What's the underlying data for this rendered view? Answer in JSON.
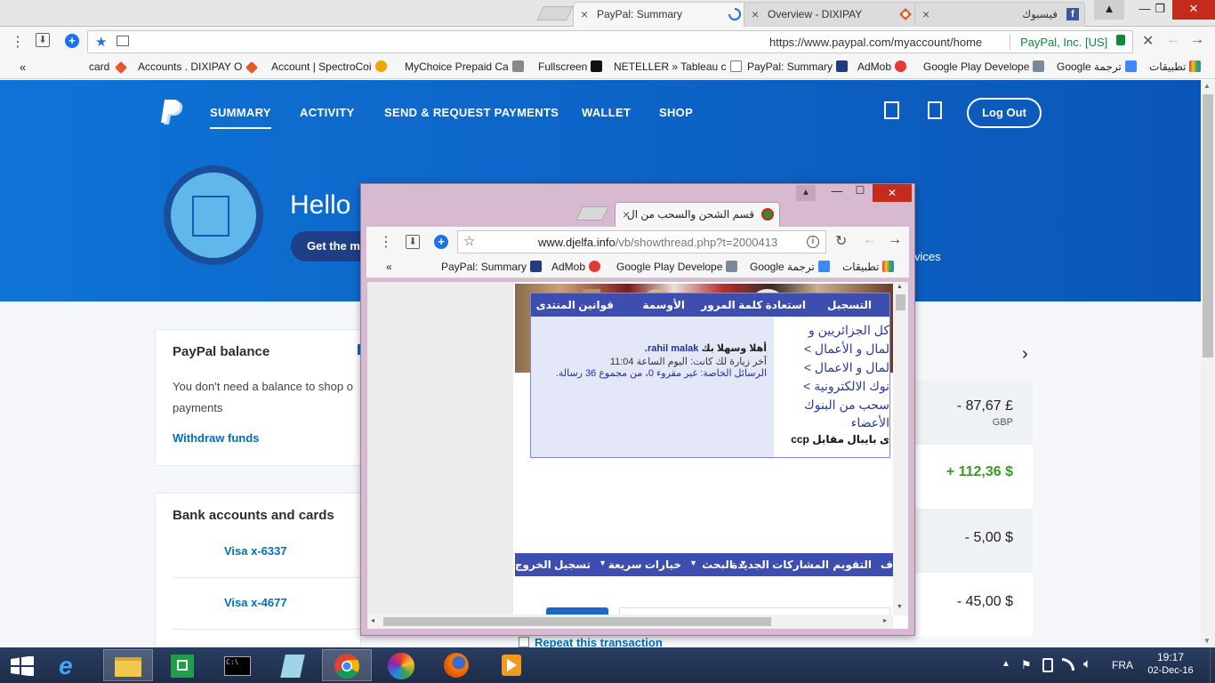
{
  "browser": {
    "tabs": [
      {
        "title": "PayPal: Summary",
        "active": true
      },
      {
        "title": "Overview - DIXIPAY",
        "active": false
      },
      {
        "title": "فيسبوك",
        "active": false
      }
    ],
    "url": "https://www.paypal.com/myaccount/home",
    "cert": "PayPal, Inc. [US]",
    "bookmarks": [
      "card",
      "Accounts . DIXIPAY O",
      "Account | SpectroCoi",
      "MyChoice Prepaid Ca",
      "Fullscreen",
      "NETELLER » Tableau c",
      "PayPal: Summary",
      "AdMob",
      "Google Play Develope",
      "Google ترجمة",
      "تطبيقات"
    ],
    "more": "«"
  },
  "paypal": {
    "nav": [
      "SUMMARY",
      "ACTIVITY",
      "SEND & REQUEST PAYMENTS",
      "WALLET",
      "SHOP"
    ],
    "logout": "Log Out",
    "greeting": "Hello",
    "get_button": "Get the m",
    "services": "vices",
    "balance_title": "PayPal balance",
    "balance_text_1": "You don't need a balance to shop o",
    "balance_text_2": "payments",
    "withdraw": "Withdraw funds",
    "bank_title": "Bank accounts and cards",
    "cards": [
      "Visa x-6337",
      "Visa x-4677"
    ],
    "transactions": [
      {
        "amount": "- 87,67 £",
        "currency": "GBP",
        "color": "#2c2e2f"
      },
      {
        "amount": "+ 112,36 $",
        "currency": "",
        "color": "#3a9a1f"
      },
      {
        "amount": "- 5,00 $",
        "currency": "",
        "color": "#2c2e2f"
      },
      {
        "amount": "- 45,00 $",
        "currency": "",
        "color": "#2c2e2f"
      }
    ],
    "repeat": "Repeat this transaction"
  },
  "popup": {
    "tab_title": "قسم الشحن والسحب من ال",
    "url_domain": "www.djelfa.info",
    "url_path": "/vb/showthread.php?t=2000413",
    "bookmarks": [
      "PayPal: Summary",
      "AdMob",
      "Google Play Develope",
      "Google ترجمة",
      "تطبيقات"
    ],
    "more": "«",
    "nav_links": [
      "التسجيل",
      "استعادة كلمة المرور",
      "الأوسمة",
      "قوانين المنتدى"
    ],
    "welcome_name": "rahil malak",
    "welcome_pre": "أهلا وسهلا بك",
    "last_visit": "آخر زيارة لك كانت: اليوم الساعة 11:04",
    "pm": "الرسائل الخاصة: غير مقروء 0، من مجموع 36 رسالة.",
    "breadcrumb": [
      "كل الجزائريين و",
      "لمال و الأعمال >",
      "لمال و الاعمال >",
      "نوك الالكترونية >",
      "سحب من البنوك",
      "الأعضاء"
    ],
    "thread_title": "ى بايبال مقابل ccp",
    "bottom_nav": [
      "تسجيل الخروج",
      "خيارات سريعة",
      "البحث",
      "المشاركات الجديدة",
      "التقويم",
      "ف"
    ]
  },
  "taskbar": {
    "time": "19:17",
    "date": "02-Dec-16",
    "lang": "FRA"
  }
}
